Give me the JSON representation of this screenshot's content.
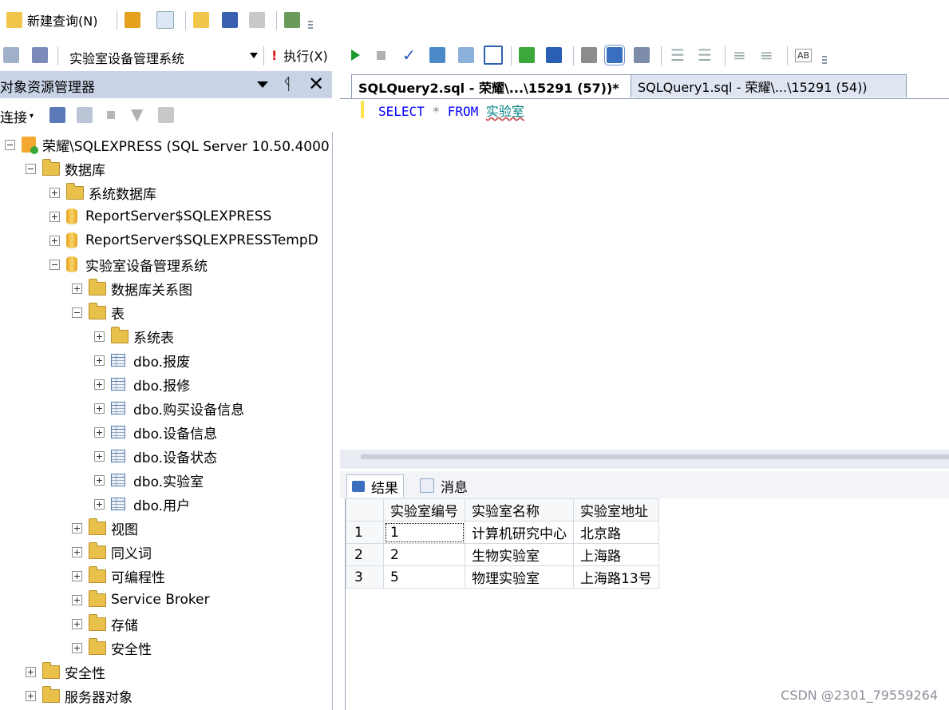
{
  "toolbar1": {
    "new_query_label": "新建查询(N)"
  },
  "toolbar2": {
    "database_selected": "实验室设备管理系统",
    "execute_label": "执行(X)"
  },
  "object_explorer": {
    "title": "对象资源管理器",
    "connect_label": "连接",
    "tree": [
      {
        "label": "荣耀\\SQLEXPRESS (SQL Server 10.50.4000",
        "level": 0,
        "expanded": true,
        "icon": "server"
      },
      {
        "label": "数据库",
        "level": 1,
        "expanded": true,
        "icon": "folder"
      },
      {
        "label": "系统数据库",
        "level": 2,
        "expanded": false,
        "icon": "folder"
      },
      {
        "label": "ReportServer$SQLEXPRESS",
        "level": 2,
        "expanded": false,
        "icon": "database"
      },
      {
        "label": "ReportServer$SQLEXPRESSTempD",
        "level": 2,
        "expanded": false,
        "icon": "database"
      },
      {
        "label": "实验室设备管理系统",
        "level": 2,
        "expanded": true,
        "icon": "database"
      },
      {
        "label": "数据库关系图",
        "level": 3,
        "expanded": false,
        "icon": "folder"
      },
      {
        "label": "表",
        "level": 3,
        "expanded": true,
        "icon": "folder"
      },
      {
        "label": "系统表",
        "level": 4,
        "expanded": false,
        "icon": "folder"
      },
      {
        "label": "dbo.报废",
        "level": 4,
        "expanded": false,
        "icon": "table"
      },
      {
        "label": "dbo.报修",
        "level": 4,
        "expanded": false,
        "icon": "table"
      },
      {
        "label": "dbo.购买设备信息",
        "level": 4,
        "expanded": false,
        "icon": "table"
      },
      {
        "label": "dbo.设备信息",
        "level": 4,
        "expanded": false,
        "icon": "table"
      },
      {
        "label": "dbo.设备状态",
        "level": 4,
        "expanded": false,
        "icon": "table"
      },
      {
        "label": "dbo.实验室",
        "level": 4,
        "expanded": false,
        "icon": "table"
      },
      {
        "label": "dbo.用户",
        "level": 4,
        "expanded": false,
        "icon": "table"
      },
      {
        "label": "视图",
        "level": 3,
        "expanded": false,
        "icon": "folder"
      },
      {
        "label": "同义词",
        "level": 3,
        "expanded": false,
        "icon": "folder"
      },
      {
        "label": "可编程性",
        "level": 3,
        "expanded": false,
        "icon": "folder"
      },
      {
        "label": "Service Broker",
        "level": 3,
        "expanded": false,
        "icon": "folder"
      },
      {
        "label": "存储",
        "level": 3,
        "expanded": false,
        "icon": "folder"
      },
      {
        "label": "安全性",
        "level": 3,
        "expanded": false,
        "icon": "folder"
      },
      {
        "label": "安全性",
        "level": 1,
        "expanded": false,
        "icon": "folder"
      },
      {
        "label": "服务器对象",
        "level": 1,
        "expanded": false,
        "icon": "folder"
      }
    ]
  },
  "editor": {
    "tabs": [
      {
        "label": "SQLQuery2.sql - 荣耀\\...\\15291 (57))*",
        "active": true
      },
      {
        "label": "SQLQuery1.sql - 荣耀\\...\\15291 (54))",
        "active": false
      }
    ],
    "code": {
      "kw1": "SELECT",
      "star": "*",
      "kw2": "FROM",
      "table": "实验室"
    }
  },
  "results": {
    "tabs": [
      {
        "label": "结果"
      },
      {
        "label": "消息"
      }
    ],
    "columns": [
      "实验室编号",
      "实验室名称",
      "实验室地址"
    ],
    "rows": [
      {
        "n": "1",
        "cells": [
          "1",
          "计算机研究中心",
          "北京路"
        ]
      },
      {
        "n": "2",
        "cells": [
          "2",
          "生物实验室",
          "上海路"
        ]
      },
      {
        "n": "3",
        "cells": [
          "5",
          "物理实验室",
          "上海路13号"
        ]
      }
    ]
  },
  "watermark": "CSDN @2301_79559264",
  "colors": {
    "header_bg": "#c8d3e6",
    "keyword": "#0000ff",
    "identifier": "#008080"
  }
}
